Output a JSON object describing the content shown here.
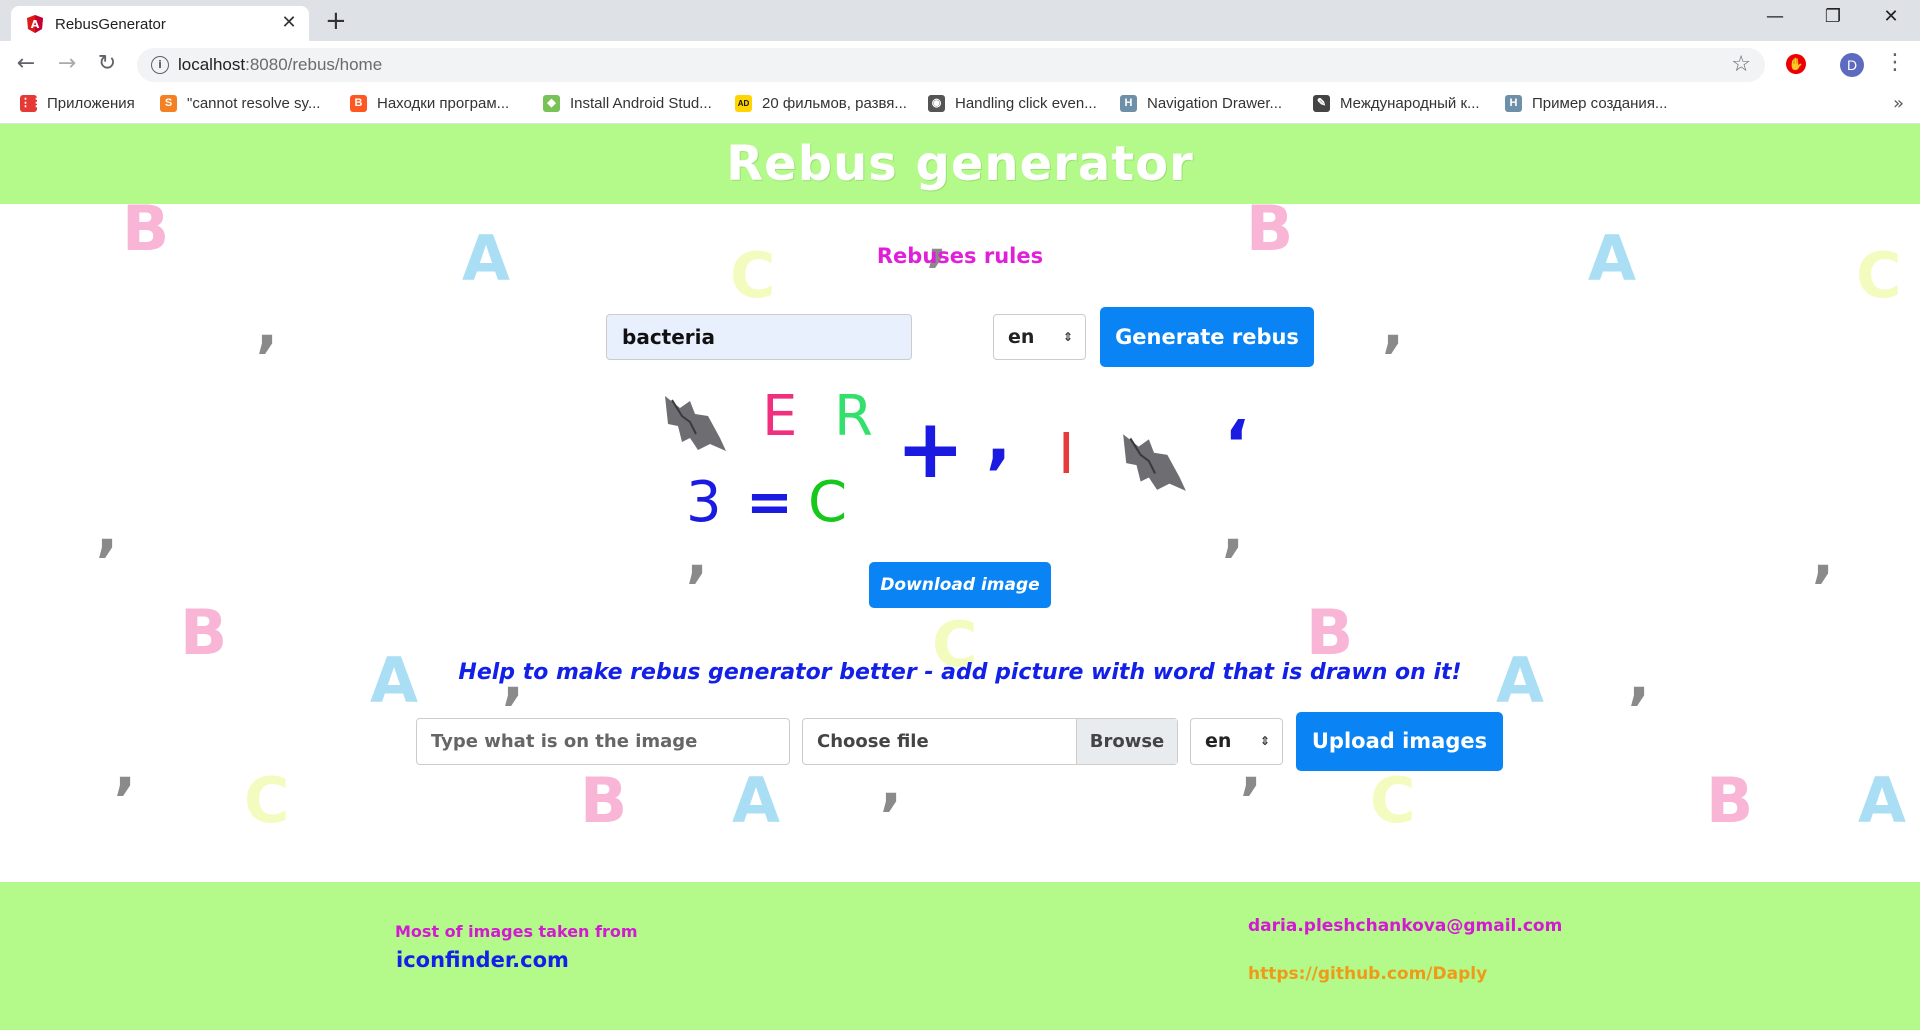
{
  "browser": {
    "tab_title": "RebusGenerator",
    "tab_close": "✕",
    "new_tab": "+",
    "url_host": "localhost",
    "url_rest": ":8080/rebus/home",
    "avatar_letter": "D",
    "window_controls": {
      "minimize": "—",
      "restore": "❐",
      "close": "✕"
    },
    "bookmarks": [
      {
        "label": "Приложения",
        "icon": "apps-grid-icon",
        "color": "#e53935"
      },
      {
        "label": "\"cannot resolve sy...",
        "icon": "stackoverflow-icon",
        "color": "#f48024"
      },
      {
        "label": "Находки програм...",
        "icon": "blogger-icon",
        "color": "#ff5722"
      },
      {
        "label": "Install Android Stud...",
        "icon": "android-icon",
        "color": "#78c257"
      },
      {
        "label": "20 фильмов, развя...",
        "icon": "ad-icon",
        "color": "#111111"
      },
      {
        "label": "Handling click even...",
        "icon": "globe-icon",
        "color": "#555555"
      },
      {
        "label": "Navigation Drawer...",
        "icon": "h-icon",
        "color": "#6d8fa8"
      },
      {
        "label": "Международный к...",
        "icon": "quill-icon",
        "color": "#444444"
      },
      {
        "label": "Пример создания...",
        "icon": "h-icon",
        "color": "#6d8fa8"
      }
    ],
    "bookmarks_more": "»"
  },
  "page": {
    "title": "Rebus generator",
    "rules_link": "Rebuses rules",
    "word_value": "bacteria",
    "lang_value": "en",
    "generate_label": "Generate rebus",
    "download_label": "Download image",
    "help_text": "Help to make rebus generator better - add picture with word that is drawn on it!",
    "image_word_placeholder": "Type what is on the image",
    "choose_file_label": "Choose file",
    "browse_label": "Browse",
    "upload_lang_value": "en",
    "upload_label": "Upload images"
  },
  "rebus": {
    "letter_e": "E",
    "letter_r": "R",
    "plus": "+",
    "comma": ",",
    "letter_i": "I",
    "quote": "‘",
    "three": "3",
    "equals": "=",
    "letter_c": "C"
  },
  "footer": {
    "images_source_label": "Most of images taken from",
    "images_source_link": "iconfinder.com",
    "email": "daria.pleshchankova@gmail.com",
    "github": "https://github.com/Daply"
  },
  "colors": {
    "header_bg": "#b3fa8a",
    "button_blue": "#0a84f5",
    "rules_magenta": "#e020d8",
    "help_blue": "#1320e8",
    "email_magenta": "#d31ad3",
    "github_orange": "#f09a1a"
  }
}
